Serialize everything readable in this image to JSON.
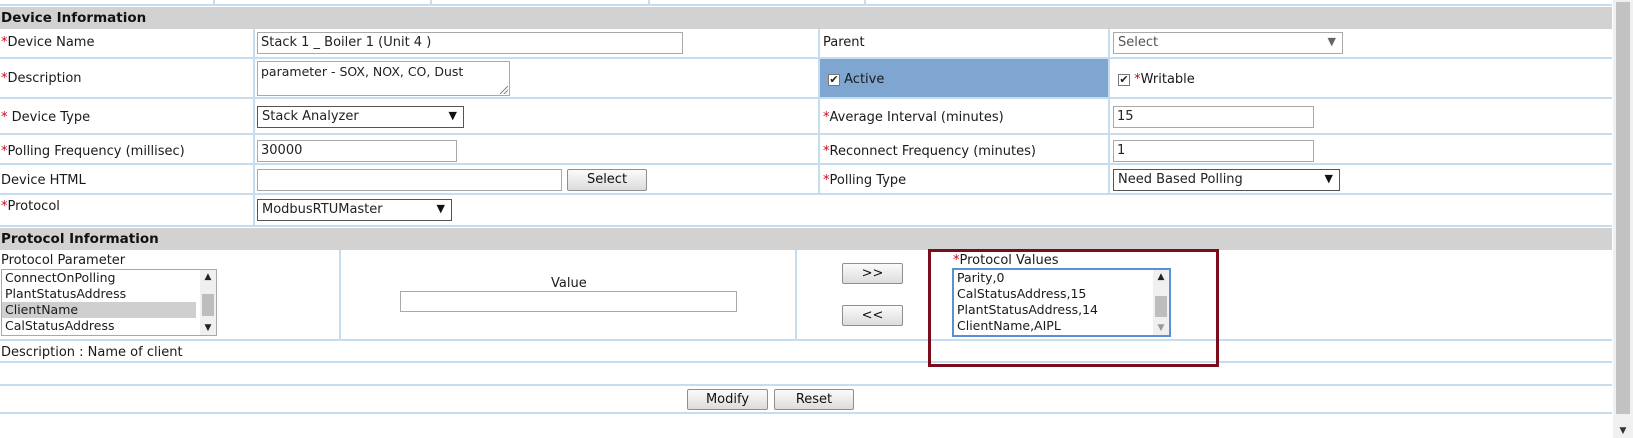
{
  "device_info": {
    "header": "Device Information",
    "req_mark": "*",
    "device_name": {
      "label": "Device Name",
      "value": "Stack 1 _ Boiler 1 (Unit 4 )"
    },
    "parent": {
      "label": "Parent",
      "value": "Select"
    },
    "description": {
      "label": "Description",
      "value": "parameter - SOX, NOX, CO, Dust"
    },
    "active": {
      "label": "Active",
      "checked": true
    },
    "writable": {
      "label": "Writable",
      "checked": true
    },
    "device_type": {
      "label": " Device Type",
      "value": "Stack Analyzer"
    },
    "average_interval": {
      "label": "Average Interval (minutes)",
      "value": "15"
    },
    "polling_frequency": {
      "label": "Polling Frequency (millisec)",
      "value": "30000"
    },
    "reconnect_frequency": {
      "label": "Reconnect Frequency (minutes)",
      "value": "1"
    },
    "device_html": {
      "label": "Device HTML",
      "value": "",
      "button": "Select"
    },
    "polling_type": {
      "label": "Polling Type",
      "value": "Need Based Polling"
    },
    "protocol": {
      "label": "Protocol",
      "value": "ModbusRTUMaster"
    }
  },
  "protocol_info": {
    "header": "Protocol Information",
    "parameter_label": "Protocol Parameter",
    "parameters": [
      "ConnectOnPolling",
      "PlantStatusAddress",
      "ClientName",
      "CalStatusAddress"
    ],
    "selected_parameter": "ClientName",
    "value_label": "Value",
    "value": "",
    "add_button": ">>",
    "remove_button": "<<",
    "values_label": "Protocol Values",
    "values": [
      "Parity,0",
      "CalStatusAddress,15",
      "PlantStatusAddress,14",
      "ClientName,AIPL"
    ],
    "description": "Description : Name of client"
  },
  "actions": {
    "modify": "Modify",
    "reset": "Reset"
  },
  "icons": {
    "dropdown": "chevron-down-icon",
    "checkbox": "checkmark-icon",
    "scroll_up": "triangle-up-icon",
    "scroll_down": "triangle-down-icon"
  },
  "colors": {
    "section_header": "#d2d2d2",
    "grid_line": "#c6dcef",
    "active_cell": "#7ea6d1",
    "required": "#d0021b",
    "highlight_box": "#7a0c1c"
  }
}
